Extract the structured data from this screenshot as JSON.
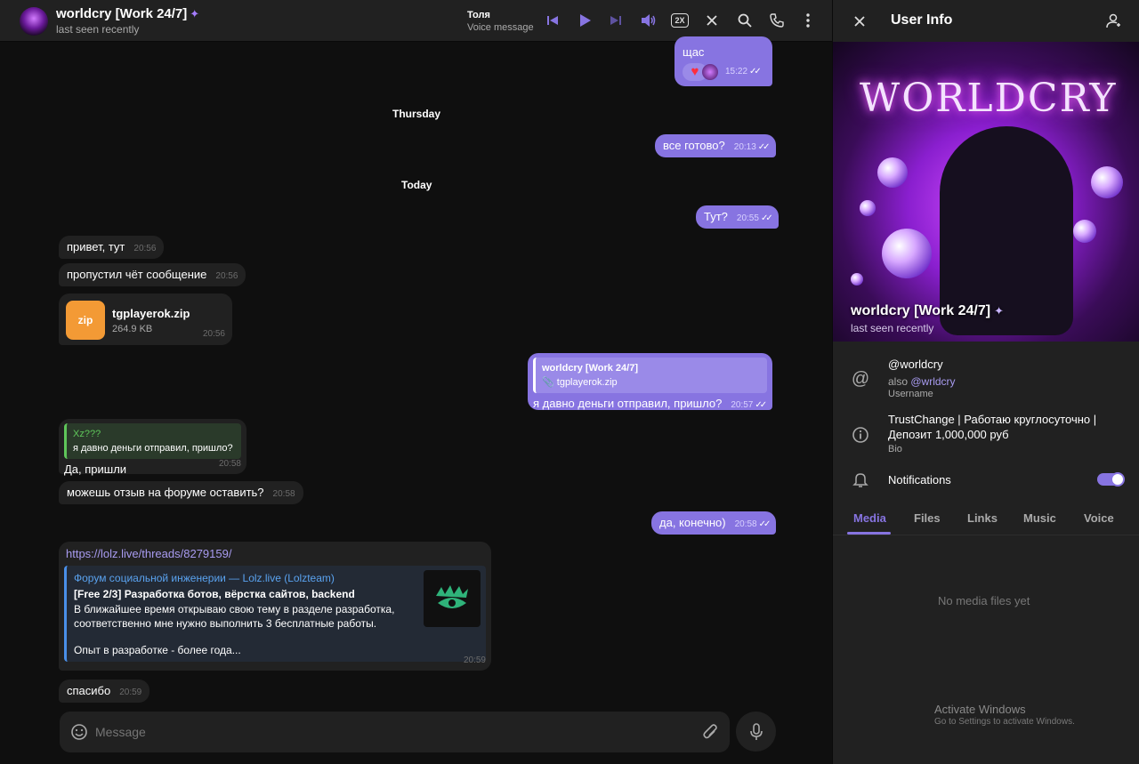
{
  "chat": {
    "title": "worldcry [Work 24/7]",
    "status": "last seen recently",
    "player": {
      "name": "Толя",
      "subtitle": "Voice message",
      "speed": "2X"
    },
    "dates": {
      "thursday": "Thursday",
      "today": "Today"
    },
    "messages": {
      "m1": {
        "text": "щас",
        "time": "15:22"
      },
      "m2": {
        "text": "все готово?",
        "time": "20:13"
      },
      "m3": {
        "text": "Тут?",
        "time": "20:55"
      },
      "m4": {
        "text": "привет, тут",
        "time": "20:56"
      },
      "m5": {
        "text": "пропустил чёт сообщение",
        "time": "20:56"
      },
      "m6": {
        "file_name": "tgplayerok.zip",
        "file_size": "264.9 KB",
        "file_ext": "zip",
        "time": "20:56"
      },
      "m7": {
        "quote_author": "worldcry [Work 24/7]",
        "quote_text": "tgplayerok.zip",
        "text": "я давно деньги отправил, пришло?",
        "time": "20:57"
      },
      "m8": {
        "quote_author": "Xz???",
        "quote_text": "я давно деньги отправил, пришло?",
        "text": "Да, пришли",
        "time": "20:58"
      },
      "m9": {
        "text": "можешь отзыв на форуме оставить?",
        "time": "20:58"
      },
      "m10": {
        "text": "да, конечно)",
        "time": "20:58"
      },
      "m11": {
        "url": "https://lolz.live/threads/8279159/",
        "site": "Форум социальной инженерии — Lolz.live (Lolzteam)",
        "title": "[Free 2/3] Разработка ботов, вёрстка сайтов, backend",
        "desc1": "В ближайшее время открываю свою тему в разделе разработка,",
        "desc2": "соответственно мне нужно выполнить 3 бесплатные работы.",
        "desc3": "Опыт в разработке - более года...",
        "time": "20:59"
      },
      "m12": {
        "text": "спасибо",
        "time": "20:59"
      }
    },
    "composer": {
      "placeholder": "Message"
    }
  },
  "info": {
    "title": "User Info",
    "cover_word": "WORLDCRY",
    "name": "worldcry [Work 24/7]",
    "status": "last seen recently",
    "username": "@worldcry",
    "also_prefix": "also ",
    "also_username": "@wrldcry",
    "username_label": "Username",
    "bio_line1": "TrustChange | Работаю круглосуточно |",
    "bio_line2": "Депозит 1,000,000 руб",
    "bio_label": "Bio",
    "notifications_label": "Notifications",
    "notifications_on": true,
    "tabs": [
      "Media",
      "Files",
      "Links",
      "Music",
      "Voice"
    ],
    "active_tab": "Media",
    "empty_text": "No media files yet"
  },
  "watermark": {
    "line1": "Activate Windows",
    "line2": "Go to Settings to activate Windows."
  },
  "colors": {
    "accent": "#8774e1",
    "incoming_bubble": "#212121",
    "outgoing_bubble": "#8774e1",
    "zip_icon": "#f39a35",
    "link": "#a89bf0"
  }
}
